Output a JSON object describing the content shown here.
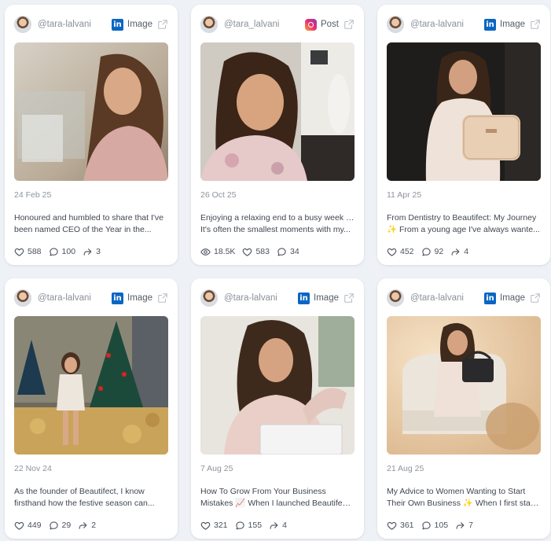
{
  "cards": [
    {
      "handle": "@tara-lalvani",
      "platform": "linkedin",
      "type_label": "Image",
      "date": "24 Feb 25",
      "caption_line1": "Honoured and humbled to share that I've",
      "caption_line2": "been named CEO of the Year in the...",
      "stats": {
        "likes": "588",
        "comments": "100",
        "shares": "3"
      }
    },
    {
      "handle": "@tara_lalvani",
      "platform": "instagram",
      "type_label": "Post",
      "date": "26 Oct 25",
      "caption_line1": "Enjoying a relaxing end to a busy week ✨",
      "caption_line2": "It's often the smallest moments with my...",
      "stats": {
        "views": "18.5K",
        "likes": "583",
        "comments": "34"
      }
    },
    {
      "handle": "@tara-lalvani",
      "platform": "linkedin",
      "type_label": "Image",
      "date": "11 Apr 25",
      "caption_line1": "From Dentistry to Beautifect: My Journey",
      "caption_line2": "✨ From a young age I've always wante...",
      "stats": {
        "likes": "452",
        "comments": "92",
        "shares": "4"
      }
    },
    {
      "handle": "@tara-lalvani",
      "platform": "linkedin",
      "type_label": "Image",
      "date": "22 Nov 24",
      "caption_line1": "As the founder of Beautifect, I know",
      "caption_line2": "firsthand how the festive season can...",
      "stats": {
        "likes": "449",
        "comments": "29",
        "shares": "2"
      }
    },
    {
      "handle": "@tara-lalvani",
      "platform": "linkedin",
      "type_label": "Image",
      "date": "7 Aug 25",
      "caption_line1": "How To Grow From Your Business",
      "caption_line2": "Mistakes 📈 When I launched Beautifect,...",
      "stats": {
        "likes": "321",
        "comments": "155",
        "shares": "4"
      }
    },
    {
      "handle": "@tara-lalvani",
      "platform": "linkedin",
      "type_label": "Image",
      "date": "21 Aug 25",
      "caption_line1": "My Advice to Women Wanting to Start",
      "caption_line2": "Their Own Business ✨ When I first starte...",
      "stats": {
        "likes": "361",
        "comments": "105",
        "shares": "7"
      }
    }
  ],
  "icons": {
    "linkedin_glyph": "in",
    "accent_linkedin": "#0a66c2"
  }
}
